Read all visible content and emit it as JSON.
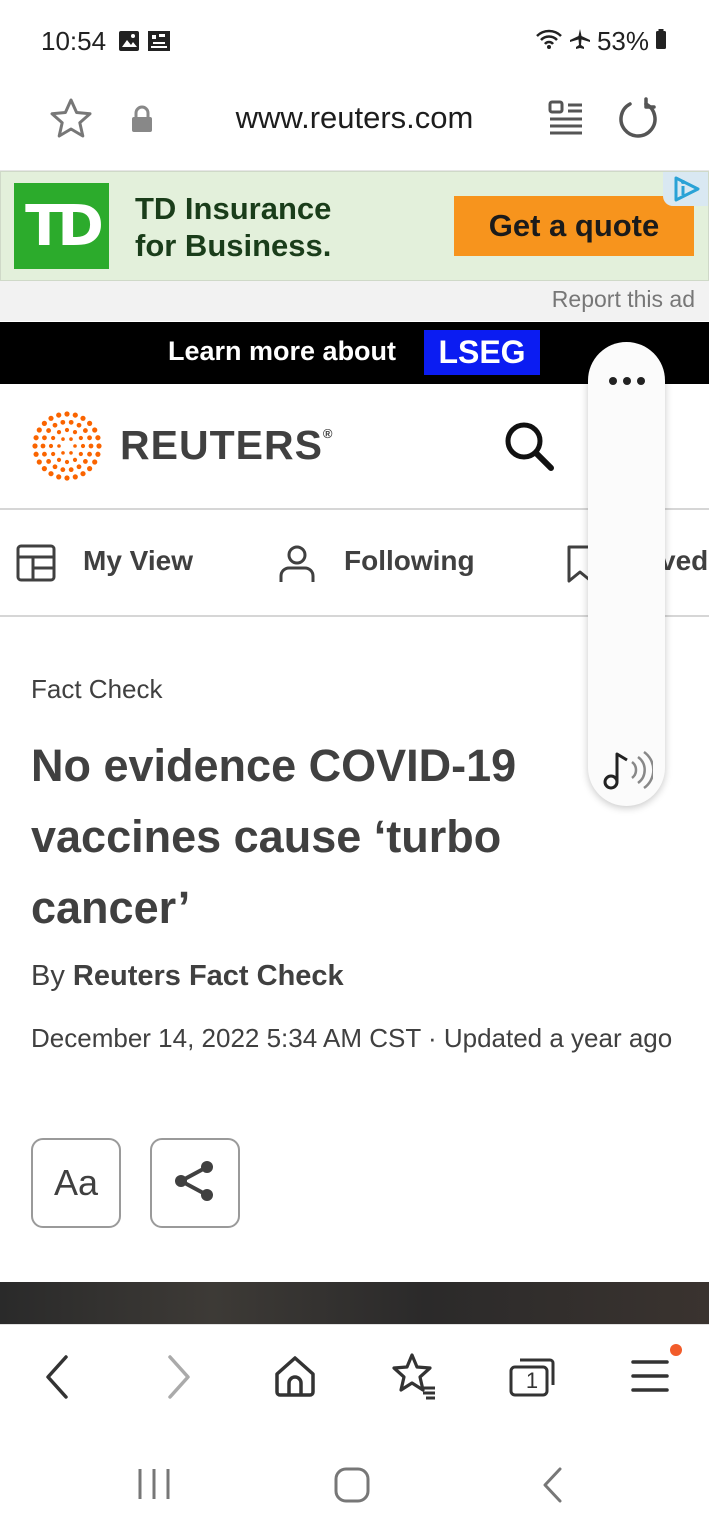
{
  "status_bar": {
    "time": "10:54",
    "battery": "53%"
  },
  "browser": {
    "url": "www.reuters.com"
  },
  "ad": {
    "brand_logo": "TD",
    "title_line1": "TD Insurance",
    "title_line2": "for Business.",
    "cta": "Get a quote",
    "report": "Report this ad"
  },
  "banner": {
    "text": "Learn more about",
    "badge": "LSEG"
  },
  "header": {
    "brand": "REUTERS",
    "reg_mark": "®"
  },
  "nav": {
    "items": [
      {
        "label": "My View",
        "icon": "layout-icon"
      },
      {
        "label": "Following",
        "icon": "person-icon"
      },
      {
        "label": "ved",
        "icon": "bookmark-icon"
      }
    ]
  },
  "article": {
    "kicker": "Fact Check",
    "headline": "No evidence COVID-19 vaccines cause ‘turbo cancer’",
    "by_prefix": "By",
    "author": "Reuters Fact Check",
    "dateline": "December 14, 2022 5:34 AM CST · Updated a year ago",
    "text_size_button": "Aa"
  },
  "bottom_toolbar": {
    "tab_count": "1"
  },
  "colors": {
    "reuters_orange": "#fa6400",
    "td_green": "#2cab2c",
    "cta_orange": "#f7941d",
    "lseg_blue": "#0b1cf2"
  }
}
